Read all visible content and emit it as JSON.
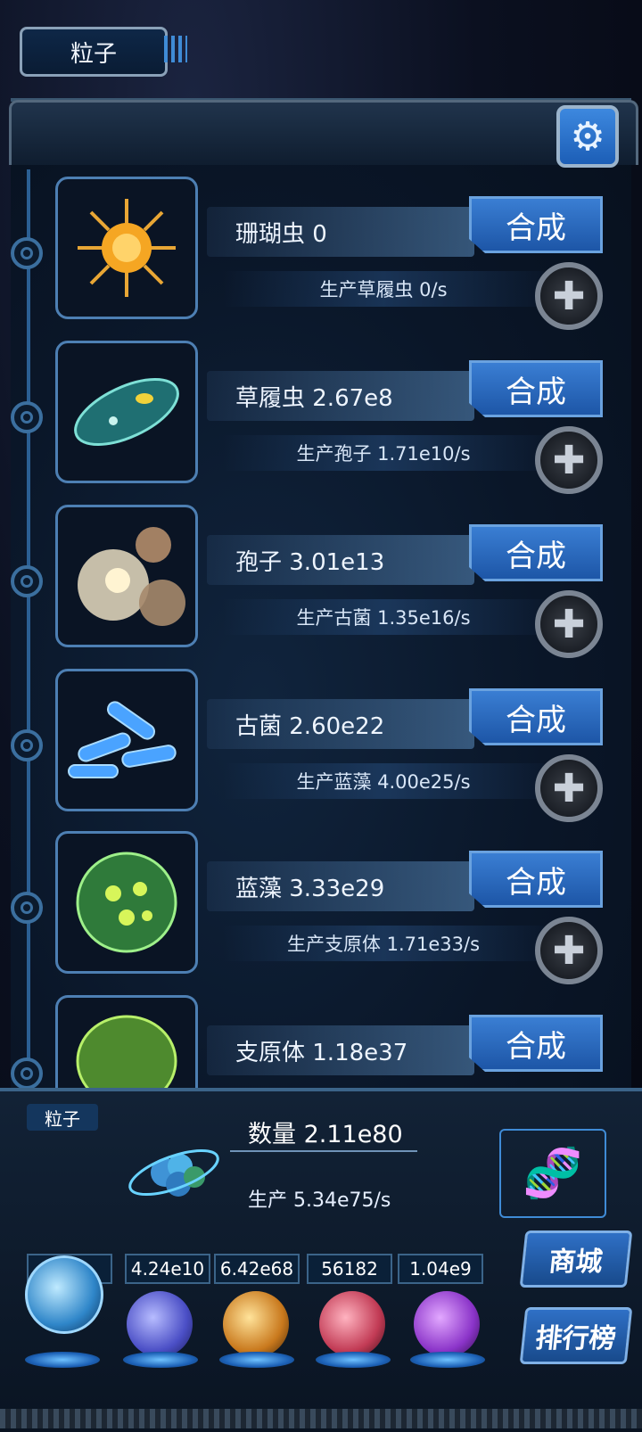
{
  "header": {
    "tab_label": "粒子",
    "settings_icon": "gear-icon"
  },
  "creatures": [
    {
      "name_count": "珊瑚虫 0",
      "merge_label": "合成",
      "production": "生产草履虫 0/s",
      "color": "#f5a623"
    },
    {
      "name_count": "草履虫 2.67e8",
      "merge_label": "合成",
      "production": "生产孢子 1.71e10/s",
      "color": "#3fa7a0"
    },
    {
      "name_count": "孢子 3.01e13",
      "merge_label": "合成",
      "production": "生产古菌 1.35e16/s",
      "color": "#c9b48a"
    },
    {
      "name_count": "古菌 2.60e22",
      "merge_label": "合成",
      "production": "生产蓝藻 4.00e25/s",
      "color": "#4aa3ff"
    },
    {
      "name_count": "蓝藻 3.33e29",
      "merge_label": "合成",
      "production": "生产支原体 1.71e33/s",
      "color": "#6fd14a"
    },
    {
      "name_count": "支原体 1.18e37",
      "merge_label": "合成",
      "production": "",
      "color": "#8bdc4f"
    }
  ],
  "resource_panel": {
    "tag": "粒子",
    "count": "数量 2.11e80",
    "rate": "生产 5.34e75/s"
  },
  "resources": [
    {
      "value": "0",
      "color": "#5fb5e8"
    },
    {
      "value": "4.24e10",
      "color": "#6f73d9"
    },
    {
      "value": "6.42e68",
      "color": "#e39a2f"
    },
    {
      "value": "56182",
      "color": "#d9506a"
    },
    {
      "value": "1.04e9",
      "color": "#9b45d8"
    }
  ],
  "side_buttons": {
    "shop": "商城",
    "ranking": "排行榜"
  }
}
